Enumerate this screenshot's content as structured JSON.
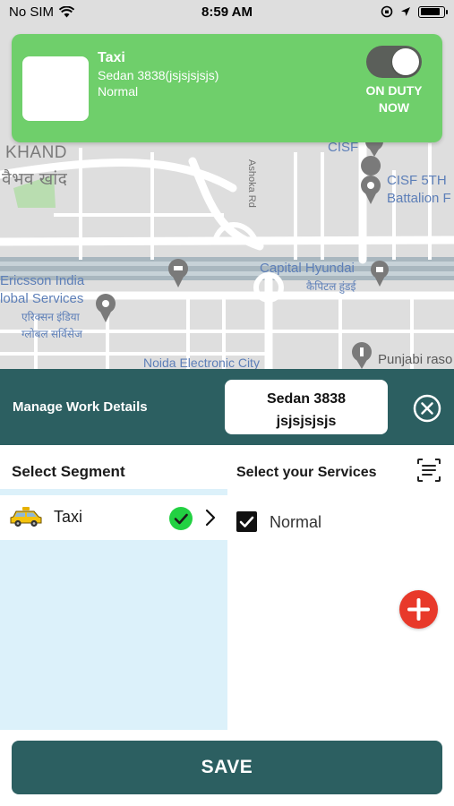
{
  "status_bar": {
    "carrier": "No SIM",
    "time": "8:59 AM",
    "battery_level": 0.85
  },
  "map": {
    "labels": {
      "khand": "KHAND",
      "khand_hindi": "वैभव खांद",
      "cisf": "CISF",
      "cisf_5th": "CISF 5TH",
      "battalion": "Battalion F",
      "ashoka_rd": "Ashoka Rd",
      "capital_hyundai": "Capital Hyundai",
      "capital_hyundai_hindi": "कैपिटल हुंडई",
      "ericsson_1": "Ericsson India",
      "ericsson_2": "lobal Services",
      "ericsson_hindi_1": "एरिक्सन इंडिया",
      "ericsson_hindi_2": "ग्लोबल सर्विसेज",
      "noida_electronic": "Noida Electronic City",
      "punjabi": "Punjabi raso"
    }
  },
  "duty_card": {
    "vehicle_type": "Taxi",
    "vehicle_model": "Sedan 3838(jsjsjsjsjs)",
    "service": "Normal",
    "toggle_on": true,
    "status_line1": "ON DUTY",
    "status_line2": "NOW"
  },
  "work_details": {
    "title": "Manage Work Details",
    "vehicle_line1": "Sedan 3838",
    "vehicle_line2": "jsjsjsjsjs"
  },
  "segments": {
    "heading": "Select Segment",
    "items": [
      {
        "label": "Taxi",
        "icon": "taxi-icon",
        "selected": true
      }
    ]
  },
  "services": {
    "heading": "Select your Services",
    "items": [
      {
        "label": "Normal",
        "checked": true
      }
    ]
  },
  "colors": {
    "teal": "#2c5f61",
    "duty_green": "#6fcf6b",
    "check_green": "#22d142",
    "add_red": "#e8392a",
    "segment_bg": "#dcf1fa"
  },
  "save_label": "SAVE"
}
